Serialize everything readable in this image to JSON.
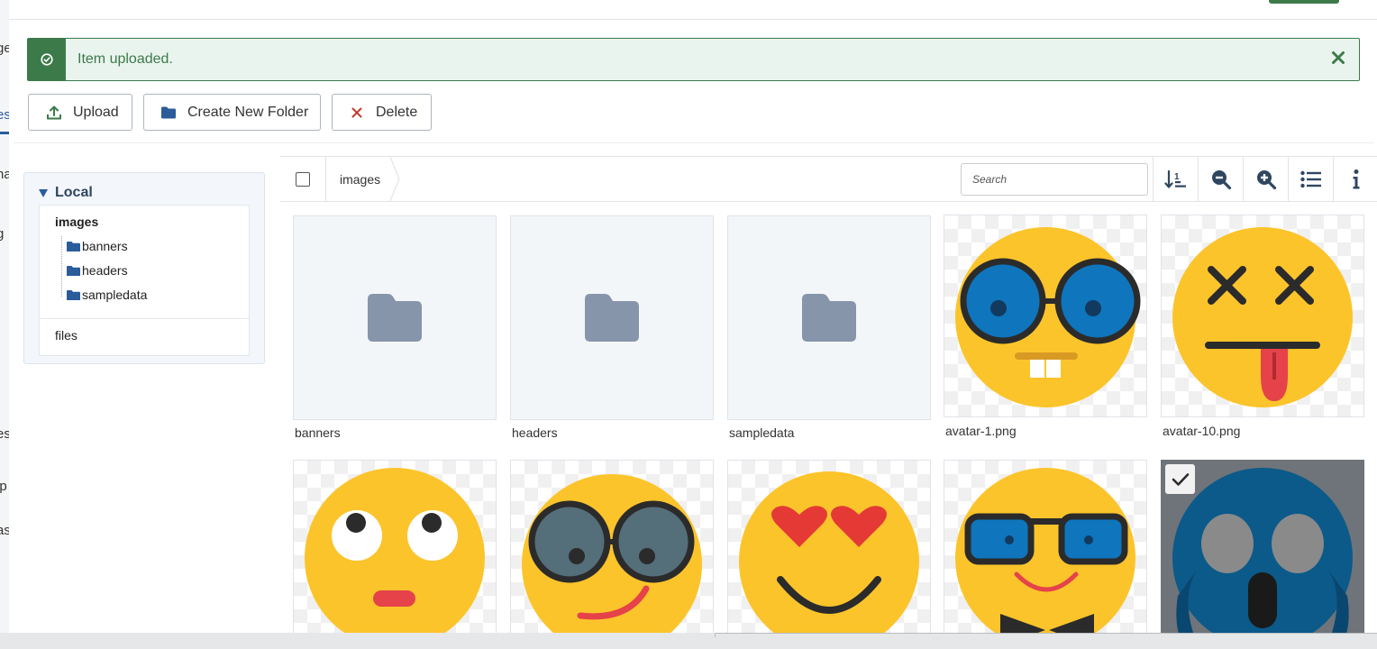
{
  "background": {
    "left_fragments": [
      "ge",
      "es",
      "na",
      "g",
      "es",
      "ip",
      "as"
    ]
  },
  "alert": {
    "message": "Item uploaded.",
    "color": "#3c7a4a"
  },
  "toolbar": {
    "upload_label": "Upload",
    "create_folder_label": "Create New Folder",
    "delete_label": "Delete"
  },
  "tree": {
    "disk_label": "Local",
    "root_label": "images",
    "subfolders": [
      "banners",
      "headers",
      "sampledata"
    ],
    "files_label": "files"
  },
  "browser": {
    "breadcrumb": "images",
    "search_placeholder": "Search",
    "tools": [
      "sort-icon",
      "zoom-out-icon",
      "zoom-in-icon",
      "list-view-icon",
      "info-icon"
    ]
  },
  "items": [
    {
      "name": "banners",
      "type": "folder"
    },
    {
      "name": "headers",
      "type": "folder"
    },
    {
      "name": "sampledata",
      "type": "folder"
    },
    {
      "name": "avatar-1.png",
      "type": "image"
    },
    {
      "name": "avatar-10.png",
      "type": "image"
    },
    {
      "name": "",
      "type": "image"
    },
    {
      "name": "",
      "type": "image"
    },
    {
      "name": "",
      "type": "image"
    },
    {
      "name": "",
      "type": "image"
    },
    {
      "name": "",
      "type": "image",
      "selected": true
    }
  ],
  "colors": {
    "accent": "#2a5c9a",
    "success": "#3c7a4a",
    "danger": "#c0392b",
    "emoji_yellow": "#fcc42b"
  }
}
